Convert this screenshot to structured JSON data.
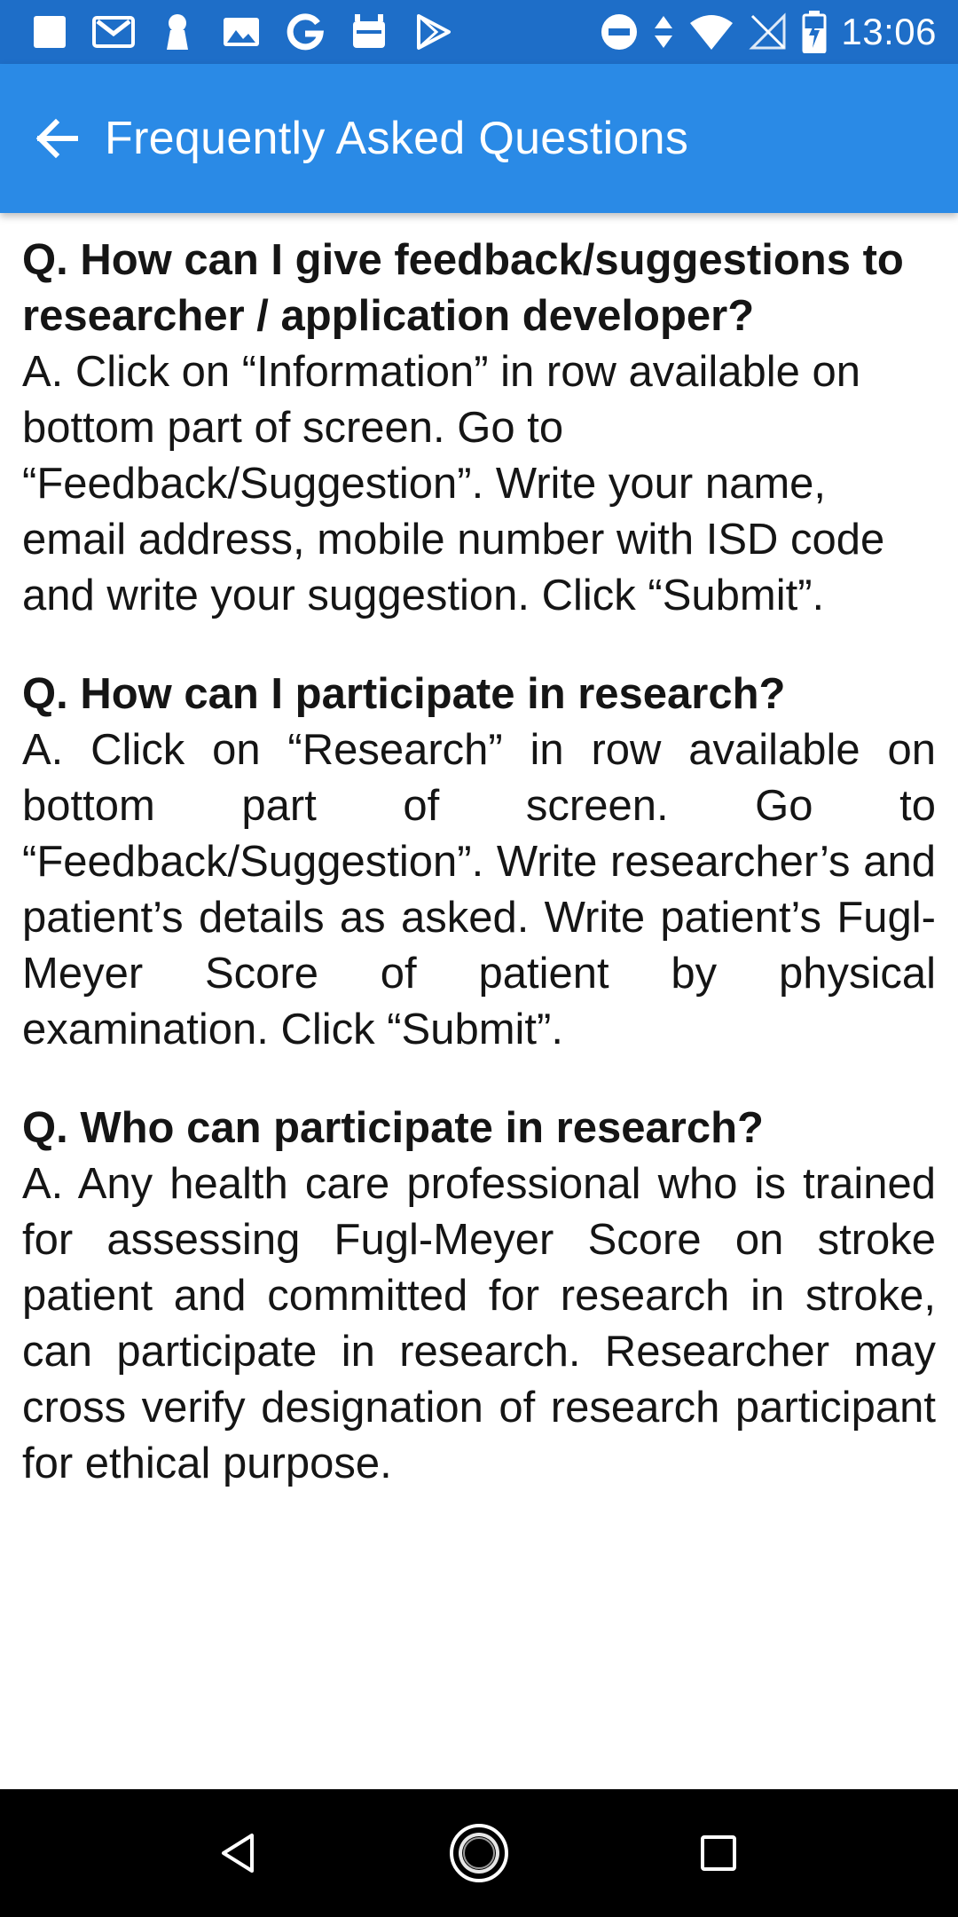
{
  "status_bar": {
    "time": "13:06",
    "left_icons": [
      "app-square-icon",
      "gmail-icon",
      "keyhole-icon",
      "gallery-icon",
      "google-icon",
      "android-icon",
      "play-store-icon"
    ],
    "right_icons": [
      "do-not-disturb-icon",
      "data-arrows-icon",
      "wifi-icon",
      "no-signal-icon",
      "battery-charging-icon"
    ]
  },
  "app_bar": {
    "title": "Frequently Asked Questions",
    "back_icon": "arrow-back-icon",
    "color": "#2a8ae6"
  },
  "faq": [
    {
      "question": "Q. How can I give feedback/suggestions to researcher / application developer?",
      "answer": "A. Click on “Information” in row available on bottom part of screen. Go to “Feedback/Suggestion”. Write your name, email address, mobile number with ISD code and write your suggestion. Click “Submit”."
    },
    {
      "question": "Q. How can I participate in research?",
      "answer": "A. Click on “Research” in row available on bottom part of screen. Go to “Feedback/Suggestion”. Write researcher’s and patient’s details as asked. Write patient’s Fugl-Meyer Score of patient by physical examination. Click “Submit”."
    },
    {
      "question": "Q. Who can participate in research?",
      "answer": "A. Any health care professional who is trained for assessing Fugl-Meyer Score on stroke patient and committed for research in stroke, can participate in research. Researcher may cross verify designation of research participant for ethical purpose."
    }
  ],
  "nav_bar": {
    "buttons": [
      "back-triangle-icon",
      "home-circle-icon",
      "recents-square-icon"
    ]
  }
}
